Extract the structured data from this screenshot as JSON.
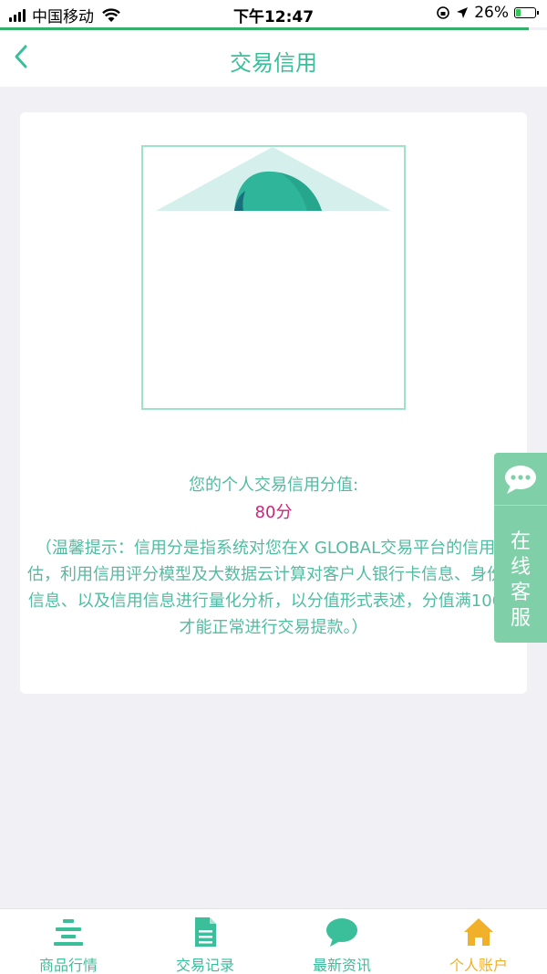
{
  "status_bar": {
    "carrier": "中国移动",
    "time": "下午12:47",
    "battery": "26%",
    "battery_level": 0.26
  },
  "nav": {
    "title": "交易信用"
  },
  "credit": {
    "score_label": "您的个人交易信用分值:",
    "score_value": "80分",
    "tip": "（温馨提示：信用分是指系统对您在X GLOBAL交易平台的信用评估，利用信用评分模型及大数据云计算对客户人银行卡信息、身份证信息、以及信用信息进行量化分析，以分值形式表述，分值满100分才能正常进行交易提款。）"
  },
  "service": {
    "label": "在线客服"
  },
  "tabs": [
    {
      "label": "商品行情",
      "icon": "market-list-icon",
      "active": false
    },
    {
      "label": "交易记录",
      "icon": "document-icon",
      "active": false
    },
    {
      "label": "最新资讯",
      "icon": "chat-bubble-icon",
      "active": false
    },
    {
      "label": "个人账户",
      "icon": "home-icon",
      "active": true
    }
  ],
  "colors": {
    "accent": "#3bbf9a",
    "score": "#c8287a",
    "active_tab": "#f0b02a",
    "service_bg": "#7fcfa8"
  }
}
